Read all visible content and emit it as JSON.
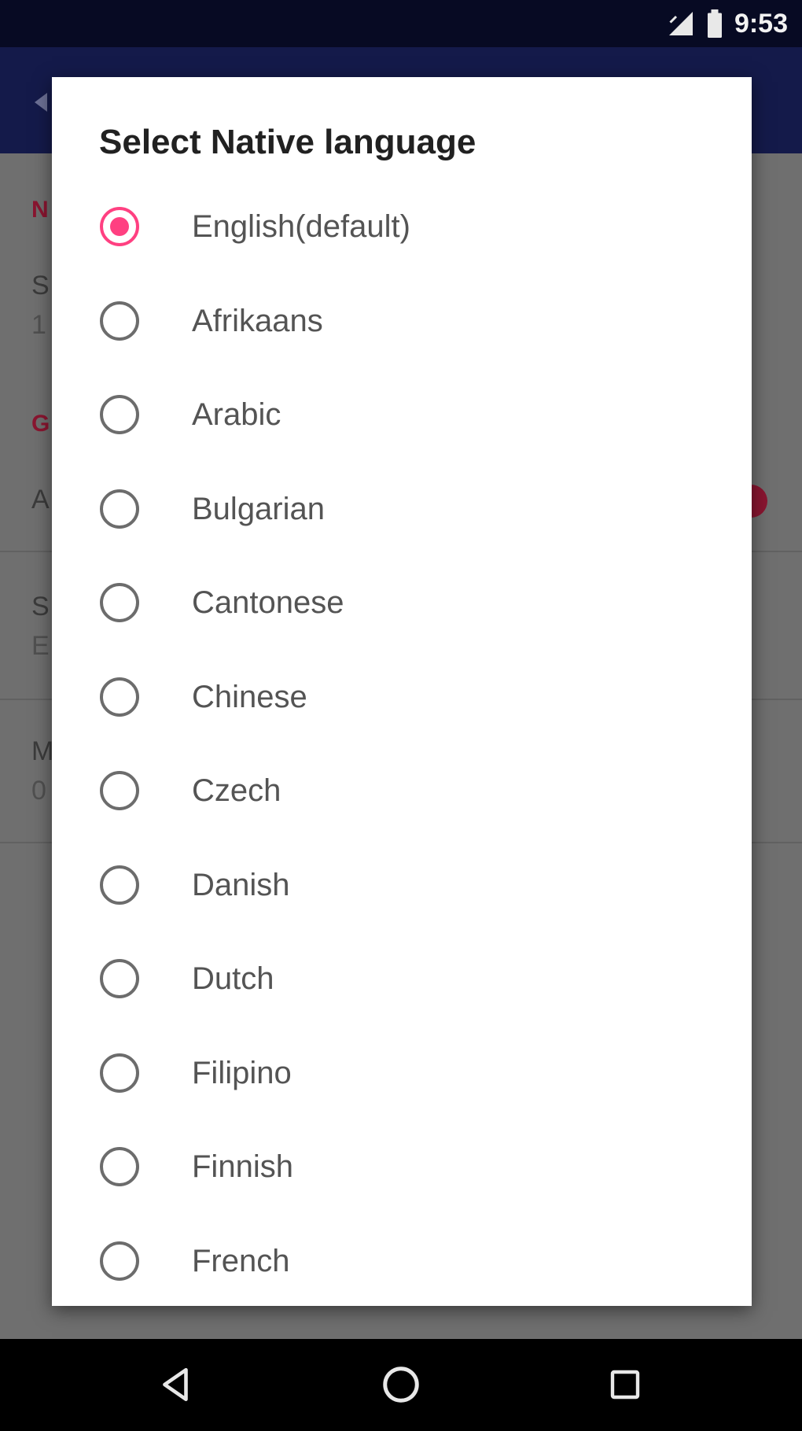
{
  "status_bar": {
    "time": "9:53",
    "icons": [
      "signal-icon",
      "battery-icon"
    ]
  },
  "dialog": {
    "title": "Select Native language",
    "selected": "English(default)",
    "accent_color": "#ff4081",
    "options": [
      {
        "label": "English(default)",
        "checked": true
      },
      {
        "label": "Afrikaans",
        "checked": false
      },
      {
        "label": "Arabic",
        "checked": false
      },
      {
        "label": "Bulgarian",
        "checked": false
      },
      {
        "label": "Cantonese",
        "checked": false
      },
      {
        "label": "Chinese",
        "checked": false
      },
      {
        "label": "Czech",
        "checked": false
      },
      {
        "label": "Danish",
        "checked": false
      },
      {
        "label": "Dutch",
        "checked": false
      },
      {
        "label": "Filipino",
        "checked": false
      },
      {
        "label": "Finnish",
        "checked": false
      },
      {
        "label": "French",
        "checked": false
      }
    ]
  },
  "background": {
    "toolbar_color": "#141a4a",
    "fragments": [
      "N",
      "S",
      "1",
      "G",
      "A",
      "S",
      "E",
      "M",
      "0"
    ]
  },
  "nav_bar": {
    "icons": [
      "back-icon",
      "home-icon",
      "recents-icon"
    ]
  }
}
